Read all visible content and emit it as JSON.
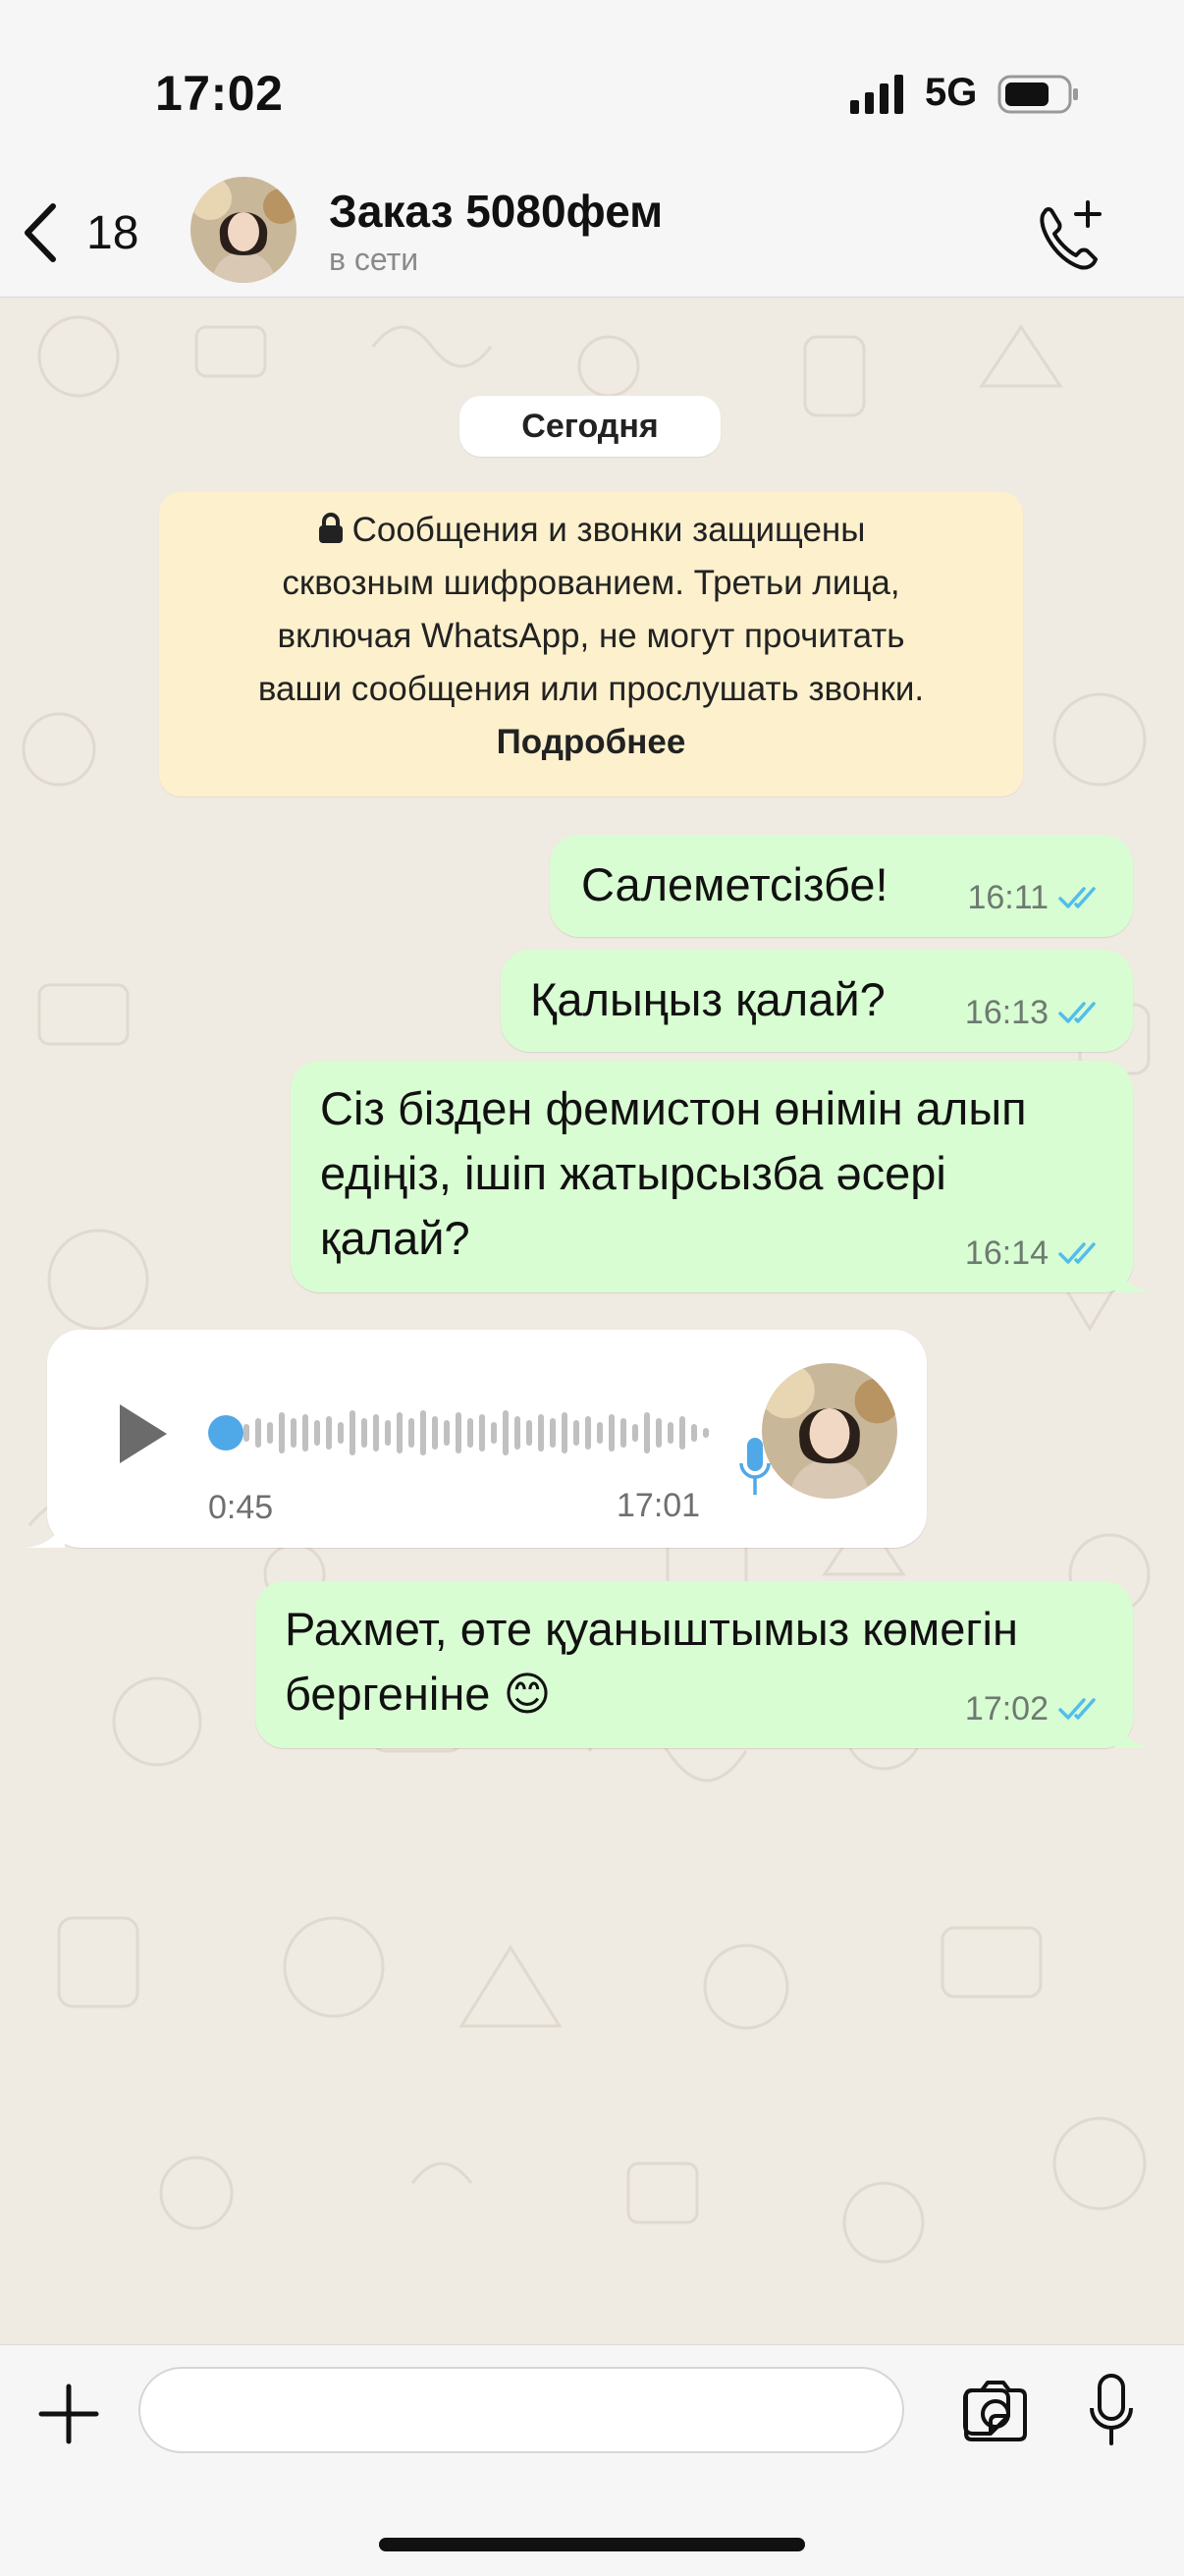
{
  "status_bar": {
    "time": "17:02",
    "network": "5G",
    "signal_icon": "cellular-signal-icon",
    "battery_icon": "battery-icon"
  },
  "header": {
    "back_count": "18",
    "contact_name": "Заказ 5080фем",
    "contact_status": "в сети",
    "back_icon": "chevron-left-icon",
    "call_icon": "add-call-icon"
  },
  "chat": {
    "date_label": "Сегодня",
    "encryption_notice": {
      "text": "Сообщения и звонки защищены сквозным шифрованием. Третьи лица, включая WhatsApp, не могут прочитать ваши сообщения или прослушать звонки.",
      "lines": [
        "Сообщения и звонки защищены",
        "сквозным шифрованием. Третьи лица,",
        "включая WhatsApp, не могут прочитать",
        "ваши сообщения или прослушать звонки."
      ],
      "link": "Подробнее",
      "icon": "lock-icon"
    },
    "messages": [
      {
        "direction": "outgoing",
        "lines": [
          "Салеметсізбе!"
        ],
        "time": "16:11",
        "status": "read"
      },
      {
        "direction": "outgoing",
        "lines": [
          "Қалыңыз қалай?"
        ],
        "time": "16:13",
        "status": "read"
      },
      {
        "direction": "outgoing",
        "lines": [
          "Сіз бізден фемистон өнімін алып",
          "едіңіз, ішіп жатырсызба әсері",
          "қалай?"
        ],
        "time": "16:14",
        "status": "read"
      },
      {
        "direction": "incoming",
        "type": "voice",
        "duration": "0:45",
        "time": "17:01",
        "progress": 0
      },
      {
        "direction": "outgoing",
        "lines": [
          "Рахмет, өте қуаныштымыз көмегін",
          "бергеніне 😊"
        ],
        "time": "17:02",
        "status": "read"
      }
    ]
  },
  "input_bar": {
    "placeholder": "",
    "attach_icon": "plus-icon",
    "sticker_icon": "sticker-icon",
    "camera_icon": "camera-icon",
    "mic_icon": "microphone-icon"
  },
  "colors": {
    "outgoing_bubble": "#d9fdd3",
    "incoming_bubble": "#ffffff",
    "chat_background": "#efeae2",
    "encryption_bg": "#fdf0cd",
    "read_ticks": "#53bdeb",
    "voice_dot": "#4fa8e8"
  }
}
